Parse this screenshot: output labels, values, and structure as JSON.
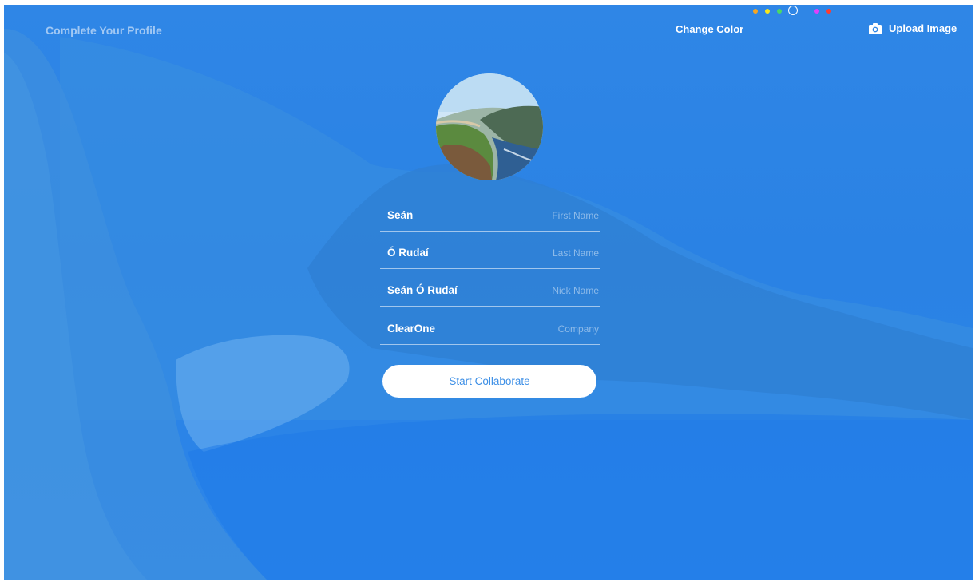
{
  "header": {
    "title": "Complete Your Profile",
    "change_color_label": "Change Color",
    "upload_label": "Upload Image"
  },
  "color_swatches": [
    {
      "name": "orange",
      "color": "#f5a623",
      "selected": false
    },
    {
      "name": "yellow",
      "color": "#f8e71c",
      "selected": false
    },
    {
      "name": "green",
      "color": "#4cd964",
      "selected": false
    },
    {
      "name": "blue",
      "color": "#2f86e6",
      "selected": true
    },
    {
      "name": "magenta",
      "color": "#e040fb",
      "selected": false
    },
    {
      "name": "red",
      "color": "#ff3b30",
      "selected": false
    }
  ],
  "avatar": {
    "icon": "landscape-photo"
  },
  "form": {
    "first_name": {
      "value": "Seán",
      "placeholder": "First Name"
    },
    "last_name": {
      "value": "Ó Rudaí",
      "placeholder": "Last Name"
    },
    "nick_name": {
      "value": "Seán Ó Rudaí",
      "placeholder": "Nick Name"
    },
    "company": {
      "value": "ClearOne",
      "placeholder": "Company"
    }
  },
  "submit_label": "Start Collaborate",
  "colors": {
    "background": "#2f86e6",
    "button_text": "#3d8fe6",
    "text": "#ffffff"
  }
}
